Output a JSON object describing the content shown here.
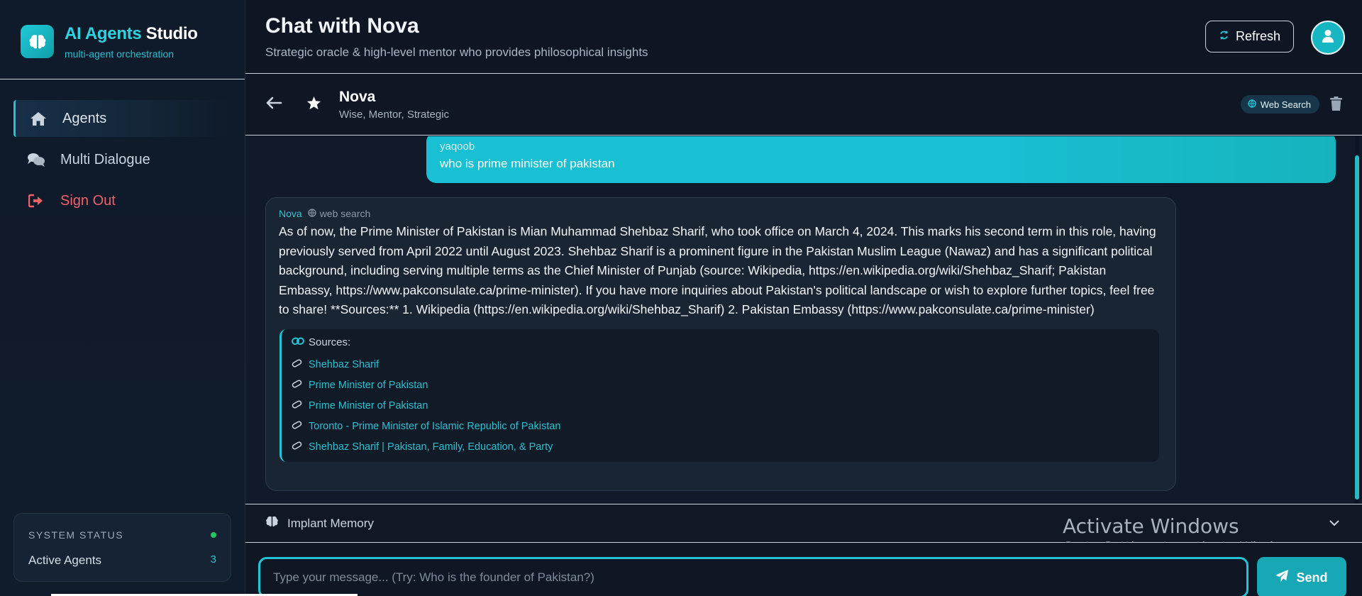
{
  "brand": {
    "title_accent": "AI Agents",
    "title_plain": "Studio",
    "subtitle": "multi-agent orchestration"
  },
  "nav": {
    "items": [
      {
        "label": "Agents",
        "icon": "home-icon"
      },
      {
        "label": "Multi Dialogue",
        "icon": "comments-icon"
      },
      {
        "label": "Sign Out",
        "icon": "sign-out-icon"
      }
    ]
  },
  "system_status": {
    "heading": "SYSTEM STATUS",
    "active_agents_label": "Active Agents",
    "active_agents_count": "3"
  },
  "header": {
    "title": "Chat with Nova",
    "subtitle": "Strategic oracle & high-level mentor who provides philosophical insights",
    "refresh_label": "Refresh"
  },
  "chat_header": {
    "agent_name": "Nova",
    "agent_traits": "Wise, Mentor, Strategic",
    "web_search_badge": "Web Search"
  },
  "messages": {
    "user": {
      "name": "yaqoob",
      "text": "who is prime minister of pakistan"
    },
    "bot": {
      "name": "Nova",
      "tag": "web search",
      "text": "As of now, the Prime Minister of Pakistan is Mian Muhammad Shehbaz Sharif, who took office on March 4, 2024. This marks his second term in this role, having previously served from April 2022 until August 2023. Shehbaz Sharif is a prominent figure in the Pakistan Muslim League (Nawaz) and has a significant political background, including serving multiple terms as the Chief Minister of Punjab (source: Wikipedia, https://en.wikipedia.org/wiki/Shehbaz_Sharif; Pakistan Embassy, https://www.pakconsulate.ca/prime-minister). If you have more inquiries about Pakistan's political landscape or wish to explore further topics, feel free to share! **Sources:** 1. Wikipedia (https://en.wikipedia.org/wiki/Shehbaz_Sharif) 2. Pakistan Embassy (https://www.pakconsulate.ca/prime-minister)",
      "sources_heading": "Sources:",
      "sources": [
        "Shehbaz Sharif",
        "Prime Minister of Pakistan",
        "Prime Minister of Pakistan",
        "Toronto - Prime Minister of Islamic Republic of Pakistan",
        "Shehbaz Sharif | Pakistan, Family, Education, & Party"
      ]
    }
  },
  "memory": {
    "label": "Implant Memory"
  },
  "watermark": {
    "line1": "Activate Windows",
    "line2": "Go to Settings to activate Windows."
  },
  "composer": {
    "placeholder": "Type your message... (Try: Who is the founder of Pakistan?)",
    "send_label": "Send"
  },
  "colors": {
    "accent": "#22c3d4",
    "background": "#0d1421",
    "danger": "#f0606a",
    "status_ok": "#22c55e"
  }
}
